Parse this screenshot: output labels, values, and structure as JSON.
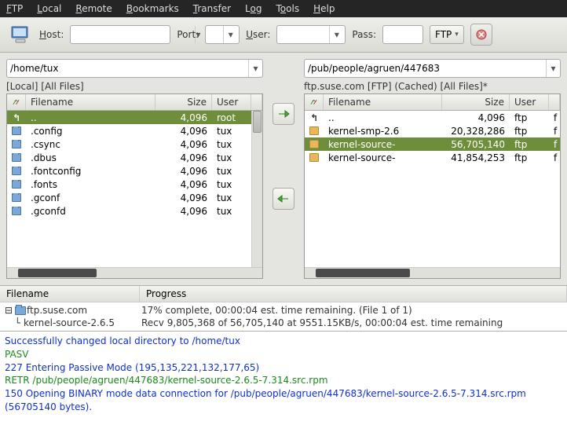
{
  "menu": {
    "items": [
      "FTP",
      "Local",
      "Remote",
      "Bookmarks",
      "Transfer",
      "Log",
      "Tools",
      "Help"
    ]
  },
  "toolbar": {
    "host_label": "Host:",
    "port_label": "Port:",
    "user_label": "User:",
    "pass_label": "Pass:",
    "proto": "FTP"
  },
  "local": {
    "path": "/home/tux",
    "status": "[Local] [All Files]",
    "cols": {
      "name": "Filename",
      "size": "Size",
      "user": "User"
    },
    "rows": [
      {
        "icon": "up",
        "name": "..",
        "size": "4,096",
        "user": "root",
        "sel": true
      },
      {
        "icon": "folder",
        "name": ".config",
        "size": "4,096",
        "user": "tux"
      },
      {
        "icon": "folder",
        "name": ".csync",
        "size": "4,096",
        "user": "tux"
      },
      {
        "icon": "folder",
        "name": ".dbus",
        "size": "4,096",
        "user": "tux"
      },
      {
        "icon": "folder",
        "name": ".fontconfig",
        "size": "4,096",
        "user": "tux"
      },
      {
        "icon": "folder",
        "name": ".fonts",
        "size": "4,096",
        "user": "tux"
      },
      {
        "icon": "folder",
        "name": ".gconf",
        "size": "4,096",
        "user": "tux"
      },
      {
        "icon": "folder",
        "name": ".gconfd",
        "size": "4,096",
        "user": "tux"
      }
    ]
  },
  "remote": {
    "path": "/pub/people/agruen/447683",
    "status": "ftp.suse.com [FTP] (Cached) [All Files]*",
    "cols": {
      "name": "Filename",
      "size": "Size",
      "user": "User"
    },
    "rows": [
      {
        "icon": "up",
        "name": "..",
        "size": "4,096",
        "user": "ftp",
        "last": "f"
      },
      {
        "icon": "pkg",
        "name": "kernel-smp-2.6",
        "size": "20,328,286",
        "user": "ftp",
        "last": "f"
      },
      {
        "icon": "pkg",
        "name": "kernel-source-",
        "size": "56,705,140",
        "user": "ftp",
        "sel": true,
        "last": "f"
      },
      {
        "icon": "pkg",
        "name": "kernel-source-",
        "size": "41,854,253",
        "user": "ftp",
        "last": "f"
      }
    ]
  },
  "transfer": {
    "cols": {
      "file": "Filename",
      "prog": "Progress"
    },
    "host": "ftp.suse.com",
    "status": "17% complete, 00:00:04 est. time remaining. (File 1 of 1)",
    "file": "kernel-source-2.6.5",
    "detail": "Recv 9,805,368 of 56,705,140 at 9551.15KB/s, 00:00:04 est. time remaining"
  },
  "log": {
    "l1": "Successfully changed local directory to /home/tux",
    "l2": "PASV",
    "l3": "227 Entering Passive Mode (195,135,221,132,177,65)",
    "l4": "RETR /pub/people/agruen/447683/kernel-source-2.6.5-7.314.src.rpm",
    "l5": "150 Opening BINARY mode data connection for /pub/people/agruen/447683/kernel-source-2.6.5-7.314.src.rpm (56705140 bytes)."
  }
}
